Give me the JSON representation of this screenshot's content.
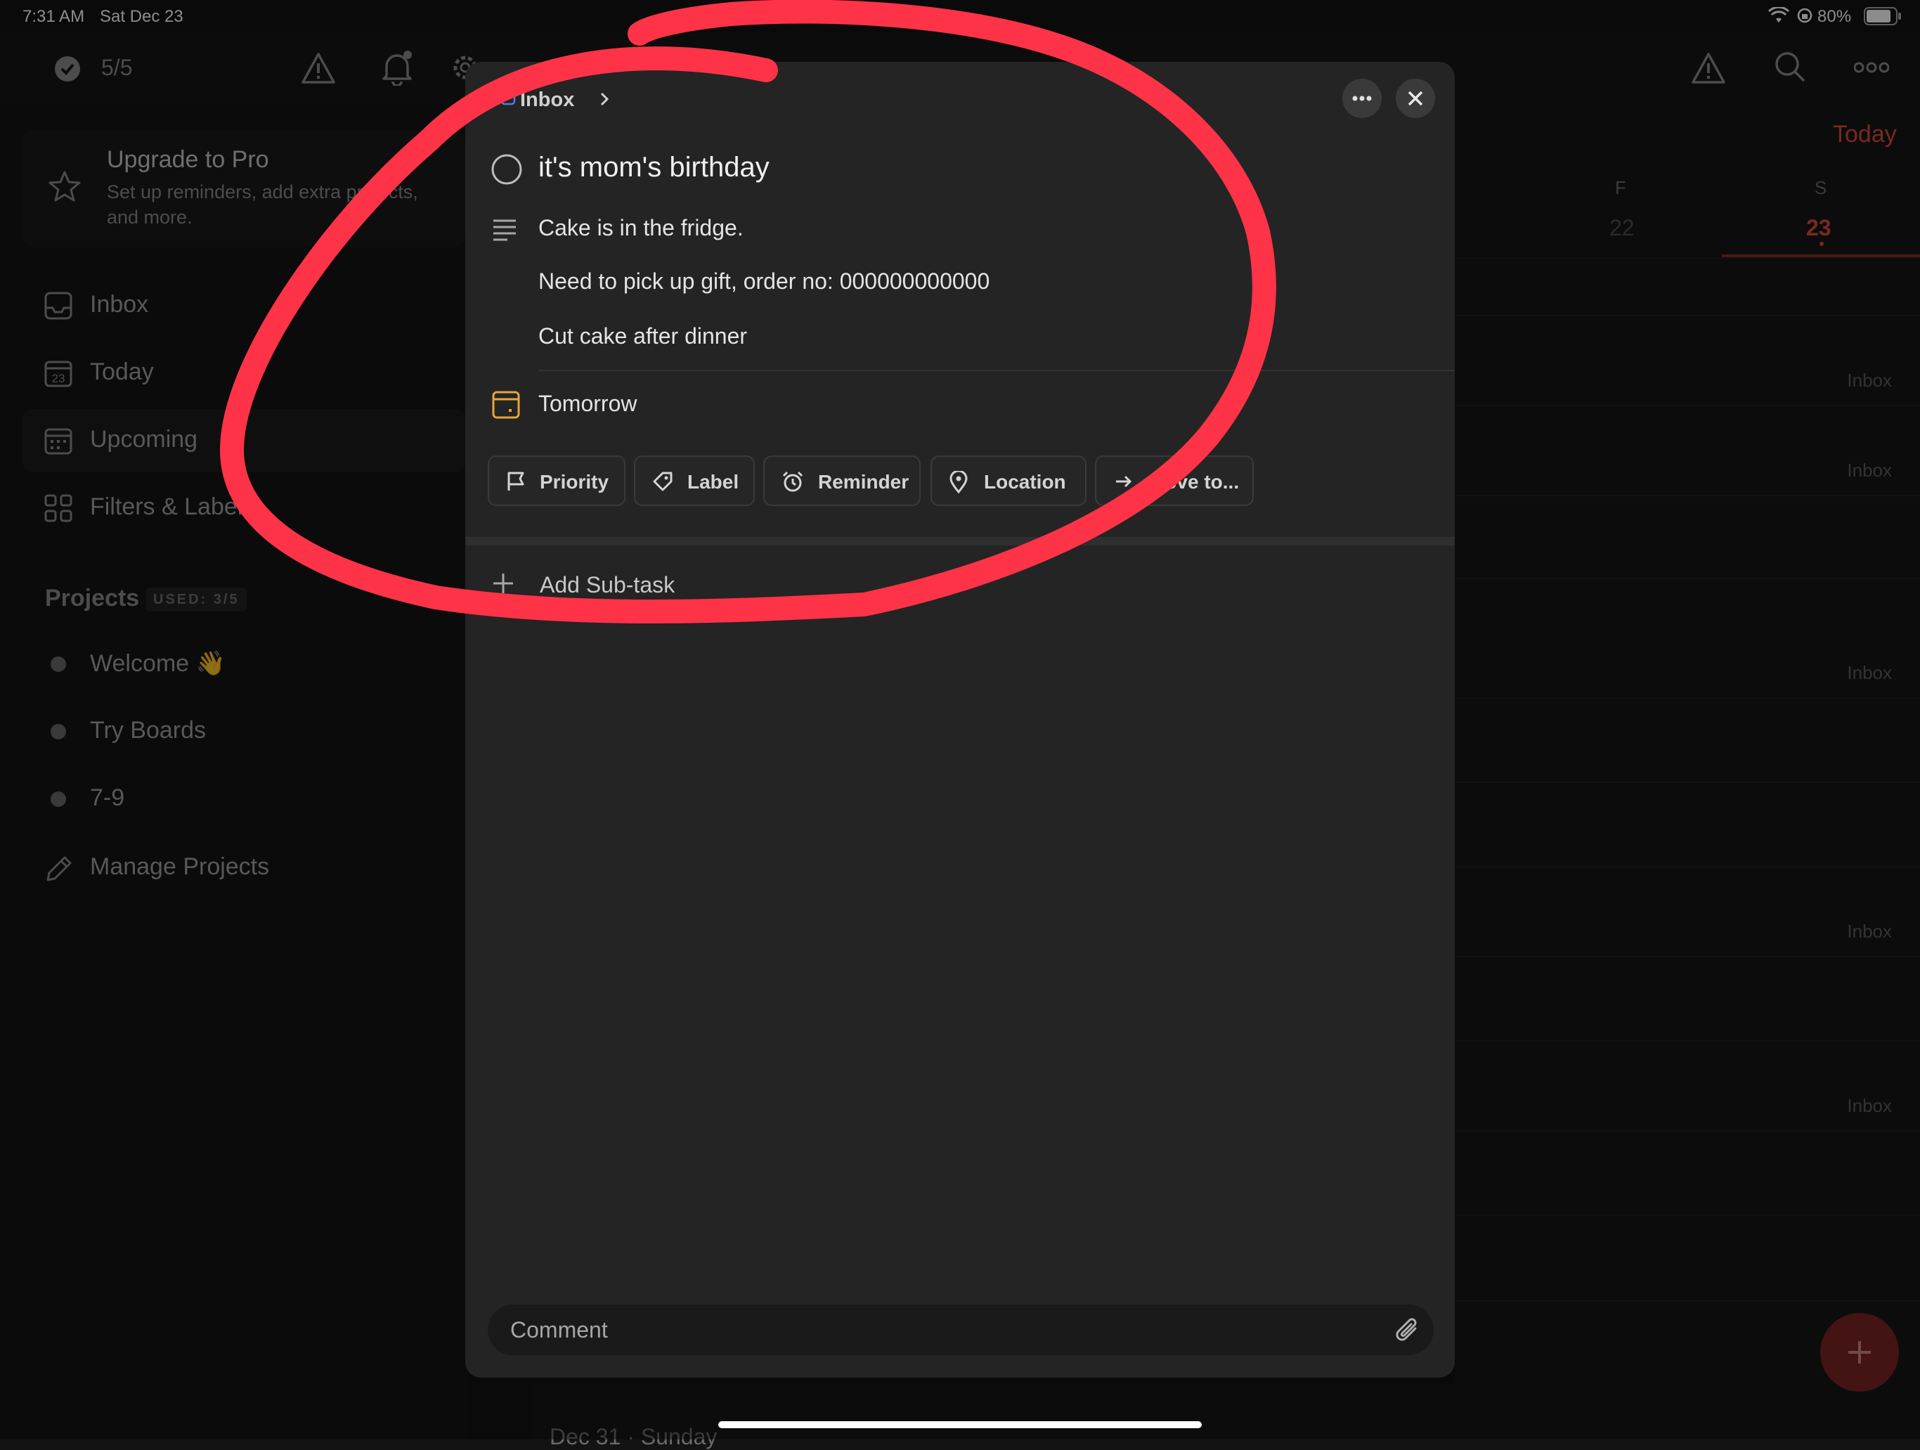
{
  "status": {
    "time": "7:31 AM",
    "date": "Sat Dec 23",
    "battery": "80%"
  },
  "topbar": {
    "count": "5/5"
  },
  "sidebar": {
    "upgrade": {
      "title": "Upgrade to Pro",
      "line1": "Set up reminders, add extra projects,",
      "line2": "and more."
    },
    "nav": [
      {
        "label": "Inbox",
        "icon": "inbox-icon"
      },
      {
        "label": "Today",
        "icon": "calendar-today-icon",
        "badge": "23"
      },
      {
        "label": "Upcoming",
        "icon": "calendar-upcoming-icon"
      },
      {
        "label": "Filters & Labels",
        "icon": "grid-icon"
      }
    ],
    "projects_title": "Projects",
    "projects_used": "USED: 3/5",
    "projects": [
      {
        "label": "Welcome 👋"
      },
      {
        "label": "Try Boards"
      },
      {
        "label": "7-9"
      }
    ],
    "manage": "Manage Projects"
  },
  "right": {
    "today": "Today",
    "days": [
      {
        "dow": "F",
        "num": "22"
      },
      {
        "dow": "S",
        "num": "23"
      }
    ],
    "inbox_tag": "Inbox",
    "bottom_hint": "Dec 31 · Sunday"
  },
  "modal": {
    "breadcrumb": "Inbox",
    "title": "it's mom's birthday",
    "description": [
      "Cake is in the fridge.",
      "Need to pick up gift, order no: 000000000000",
      "Cut cake after dinner"
    ],
    "due": "Tomorrow",
    "actions": {
      "priority": "Priority",
      "label": "Label",
      "reminder": "Reminder",
      "location": "Location",
      "move": "Move to..."
    },
    "add_subtask": "Add Sub-task",
    "comment_placeholder": "Comment"
  },
  "colors": {
    "accent": "#dc4c3e",
    "annotation": "#ff3347",
    "due": "#e8a33b"
  }
}
